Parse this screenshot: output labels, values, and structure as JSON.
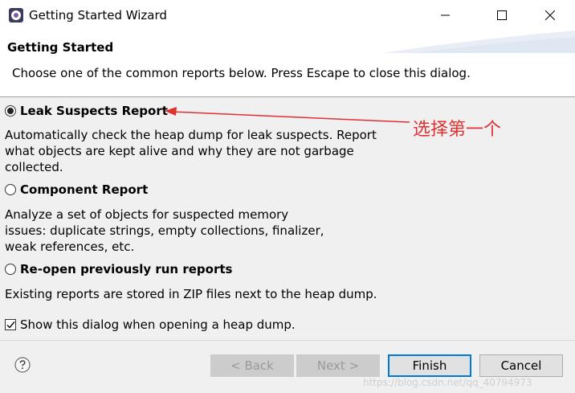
{
  "window": {
    "title": "Getting Started Wizard",
    "controls": [
      "minimize-icon",
      "maximize-icon",
      "close-icon"
    ]
  },
  "header": {
    "title": "Getting Started",
    "description": "Choose one of the common reports below. Press Escape to close this dialog."
  },
  "options": [
    {
      "label": "Leak Suspects Report",
      "selected": true,
      "description": "Automatically check the heap dump for leak suspects. Report what objects are kept alive and why they are not garbage collected."
    },
    {
      "label": "Component Report",
      "selected": false,
      "description": "Analyze a set of objects for suspected memory issues: duplicate strings, empty collections, finalizer, weak references, etc."
    },
    {
      "label": "Re-open previously run reports",
      "selected": false,
      "description": "Existing reports are stored in ZIP files next to the heap dump."
    }
  ],
  "show_dialog_checkbox": {
    "label": "Show this dialog when opening a heap dump.",
    "checked": true
  },
  "annotation": {
    "text": "选择第一个",
    "color": "#e03030"
  },
  "buttons": {
    "back": "< Back",
    "next": "Next >",
    "finish": "Finish",
    "cancel": "Cancel"
  },
  "watermark": "https://blog.csdn.net/qq_40794973",
  "colors": {
    "accent": "#0078d7",
    "annotation": "#e03030"
  }
}
